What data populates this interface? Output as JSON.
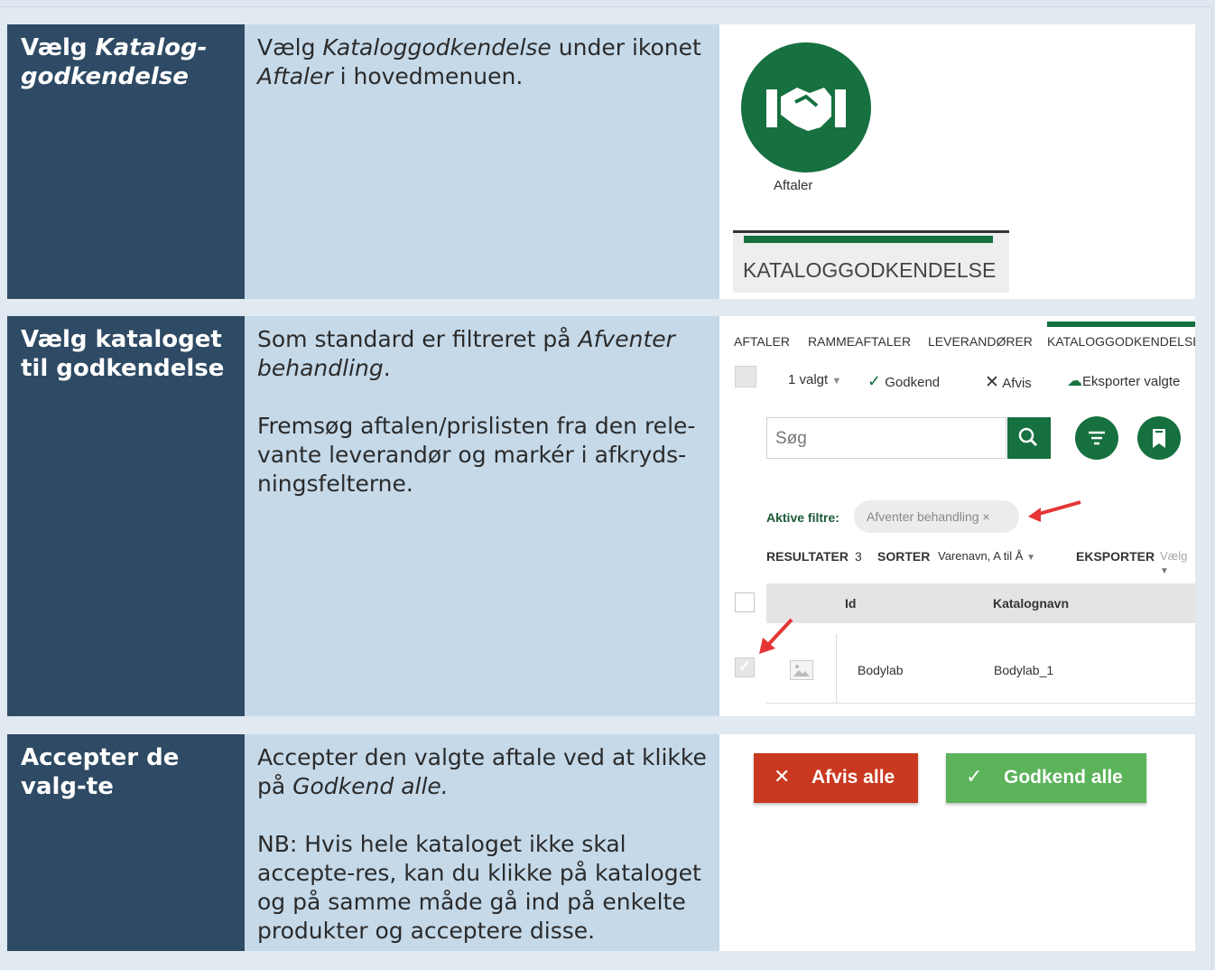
{
  "rows": [
    {
      "heading_a": "Vælg ",
      "heading_b": "Katalog-godkendelse",
      "p1_a": "Vælg ",
      "p1_b": "Kataloggodkendelse",
      "p1_c": " under ikonet ",
      "p1_d": "Aftaler",
      "p1_e": " i hovedmenuen.",
      "icon_label": "Aftaler",
      "tab_label": "KATALOGGODKENDELSE"
    },
    {
      "heading": "Vælg kataloget til godkendelse",
      "p1_a": "Som standard er filtreret på ",
      "p1_b": "Afventer behandling",
      "p1_c": ".",
      "p2": "Fremsøg aftalen/prislisten fra den rele-vante leverandør og markér i afkryds-ningsfelterne."
    },
    {
      "heading": "Accepter de valg-te",
      "p1_a": "Accepter den valgte aftale ved at klikke på ",
      "p1_b": "Godkend alle.",
      "p2": "NB: Hvis hele kataloget ikke skal accepte-res, kan du klikke på kataloget og på samme måde gå ind på enkelte produkter og acceptere disse."
    }
  ],
  "screenshot": {
    "nav": [
      "AFTALER",
      "RAMMEAFTALER",
      "LEVERANDØRER",
      "KATALOGGODKENDELSE"
    ],
    "selected": "1 valgt",
    "approve": "Godkend",
    "reject": "Afvis",
    "export_selected": "Eksporter valgte",
    "search_placeholder": "Søg",
    "active_filters_label": "Aktive filtre:",
    "filter_chip": "Afventer behandling ×",
    "results_label": "RESULTATER",
    "results_count": "3",
    "sort_label": "SORTER",
    "sort_value": "Varenavn, A til Å",
    "export_label": "EKSPORTER",
    "export_value": "Vælg",
    "col_id": "Id",
    "col_name": "Katalognavn",
    "row_id": "Bodylab",
    "row_name": "Bodylab_1"
  },
  "buttons": {
    "reject_all": "Afvis alle",
    "approve_all": "Godkend alle"
  },
  "colors": {
    "dark": "#2e4a64",
    "light": "#c5d9e9",
    "green": "#16703f",
    "red": "#c9381f",
    "lightgreen": "#5bb35a"
  }
}
